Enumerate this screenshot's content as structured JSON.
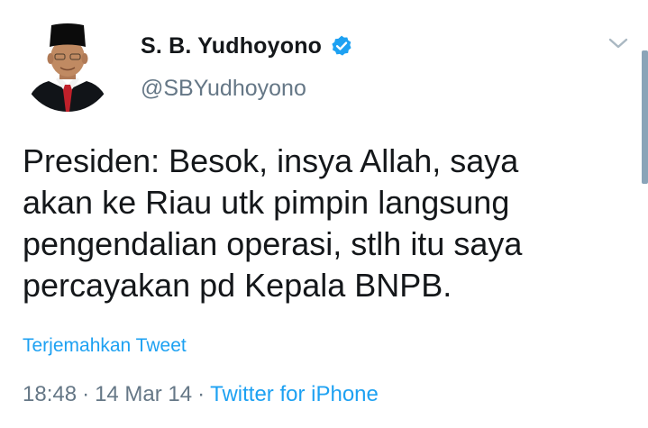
{
  "author": {
    "display_name": "S. B. Yudhoyono",
    "handle": "@SBYudhoyono",
    "verified": true,
    "verified_color": "#1da1f2"
  },
  "tweet": {
    "text": "Presiden: Besok, insya Allah, saya\nakan ke Riau utk pimpin langsung\npengendalian operasi, stlh itu saya\npercayakan pd Kepala BNPB.",
    "translate_label": "Terjemahkan Tweet",
    "time": "18:48",
    "date": "14 Mar 14",
    "separator": "·",
    "source": "Twitter for iPhone"
  },
  "icons": {
    "avatar": "profile-photo",
    "verified": "verified-badge-icon",
    "menu": "chevron-down-icon"
  },
  "colors": {
    "text": "#14171a",
    "secondary": "#657786",
    "link": "#1da1f2"
  }
}
